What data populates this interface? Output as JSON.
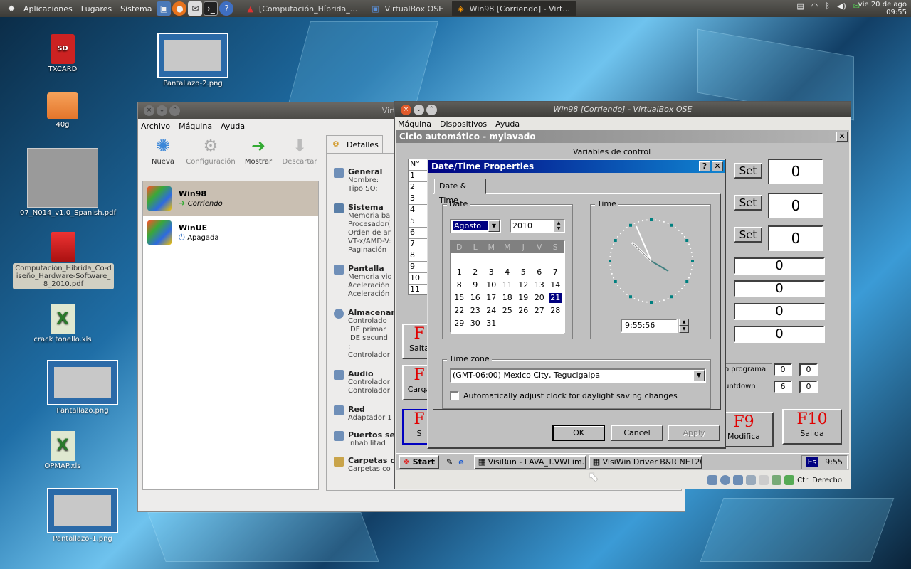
{
  "top_panel": {
    "menus": [
      "Aplicaciones",
      "Lugares",
      "Sistema"
    ],
    "tasks": [
      {
        "label": "[Computación_Híbrida_..."
      },
      {
        "label": "VirtualBox OSE"
      },
      {
        "label": "Win98 [Corriendo] - Virt..."
      }
    ],
    "clock_date": "vie 20 de ago",
    "clock_time": "09:55"
  },
  "desktop_icons": [
    {
      "label": "TXCARD",
      "icon": "sd-card-icon"
    },
    {
      "label": "Pantallazo-2.png",
      "icon": "image-thumbnail-icon"
    },
    {
      "label": "40g",
      "icon": "folder-icon"
    },
    {
      "label": "07_N014_v1.0_Spanish.pdf",
      "icon": "pdf-thumbnail-icon"
    },
    {
      "label": "Computación_Híbrida_Co-diseño_Hardware-Software_8_2010.pdf",
      "icon": "pdf-icon"
    },
    {
      "label": "crack tonello.xls",
      "icon": "spreadsheet-icon"
    },
    {
      "label": "Pantallazo.png",
      "icon": "image-thumbnail-icon"
    },
    {
      "label": "OPMAP.xls",
      "icon": "spreadsheet-icon"
    },
    {
      "label": "Pantallazo-1.png",
      "icon": "image-thumbnail-icon"
    }
  ],
  "vb_manager": {
    "title": "VirtualBox OSE",
    "menu": [
      "Archivo",
      "Máquina",
      "Ayuda"
    ],
    "tools": [
      {
        "label": "Nueva",
        "enabled": true
      },
      {
        "label": "Configuración",
        "enabled": false
      },
      {
        "label": "Mostrar",
        "enabled": true
      },
      {
        "label": "Descartar",
        "enabled": false
      }
    ],
    "vms": [
      {
        "name": "Win98",
        "state": "Corriendo",
        "badge": "98"
      },
      {
        "name": "WinUE",
        "state": "Apagada",
        "badge": "xp"
      }
    ],
    "details_tab": "Detalles",
    "sections": [
      {
        "title": "General",
        "lines": [
          "Nombre:",
          "Tipo SO:"
        ]
      },
      {
        "title": "Sistema",
        "lines": [
          "Memoria ba",
          "Procesador(",
          "Orden de ar",
          "VT-x/AMD-V:",
          "Paginación"
        ]
      },
      {
        "title": "Pantalla",
        "lines": [
          "Memoria vid",
          "Aceleración",
          "Aceleración"
        ]
      },
      {
        "title": "Almacenam",
        "lines": [
          "Controlado",
          "  IDE primar",
          "  IDE secund",
          ":",
          "Controlador"
        ]
      },
      {
        "title": "Audio",
        "lines": [
          "Controlador",
          "Controlador"
        ]
      },
      {
        "title": "Red",
        "lines": [
          "Adaptador 1"
        ]
      },
      {
        "title": "Puertos se",
        "lines": [
          "Inhabilitad"
        ]
      },
      {
        "title": "Carpetas c",
        "lines": [
          "Carpetas co"
        ]
      }
    ]
  },
  "vb_window": {
    "title": "Win98 [Corriendo] - VirtualBox OSE",
    "menu": [
      "Máquina",
      "Dispositivos",
      "Ayuda"
    ],
    "status_host_key": "Ctrl Derecho"
  },
  "guest_app": {
    "title": "Ciclo automático - mylavado",
    "variables_label": "Variables de control",
    "set_label": "Set",
    "set_values": [
      "0",
      "0",
      "0"
    ],
    "value_boxes": [
      "0",
      "0",
      "0",
      "0"
    ],
    "rows": [
      "1",
      "2",
      "3",
      "4",
      "5",
      "6",
      "7",
      "8",
      "9",
      "10",
      "11"
    ],
    "row_header": "N°",
    "program_label": "o programa",
    "countdown_label": "untdown",
    "program_values": [
      "0",
      "0"
    ],
    "countdown_values": [
      "6",
      "0"
    ],
    "left_buttons": [
      {
        "key": "F",
        "label": "Salta"
      },
      {
        "key": "F",
        "label": "Carga"
      },
      {
        "key": "F",
        "label": "S"
      }
    ],
    "f9": {
      "key": "F9",
      "label": "Modifica"
    },
    "f10": {
      "key": "F10",
      "label": "Salida"
    }
  },
  "datetime_dialog": {
    "title": "Date/Time Properties",
    "tab": "Date & Time",
    "date_group": "Date",
    "month": "Agosto",
    "year": "2010",
    "weekday_headers": [
      "D",
      "L",
      "M",
      "M",
      "J",
      "V",
      "S"
    ],
    "days": [
      "",
      "",
      "",
      "",
      "",
      "",
      "",
      "1",
      "2",
      "3",
      "4",
      "5",
      "6",
      "7",
      "8",
      "9",
      "10",
      "11",
      "12",
      "13",
      "14",
      "15",
      "16",
      "17",
      "18",
      "19",
      "20",
      "21",
      "22",
      "23",
      "24",
      "25",
      "26",
      "27",
      "28",
      "29",
      "30",
      "31"
    ],
    "selected_day": "21",
    "time_group": "Time",
    "time_value": "9:55:56",
    "timezone_group": "Time zone",
    "timezone": "(GMT-06:00) Mexico City, Tegucigalpa",
    "dst_label": "Automatically adjust clock for daylight saving changes",
    "dst_checked": false,
    "ok_label": "OK",
    "cancel_label": "Cancel",
    "apply_label": "Apply"
  },
  "guest_taskbar": {
    "start": "Start",
    "items": [
      "VisiRun  - LAVA_T.VWI im...",
      "VisiWin Driver B&R NET20..."
    ],
    "lang": "Es",
    "clock": "9:55"
  }
}
